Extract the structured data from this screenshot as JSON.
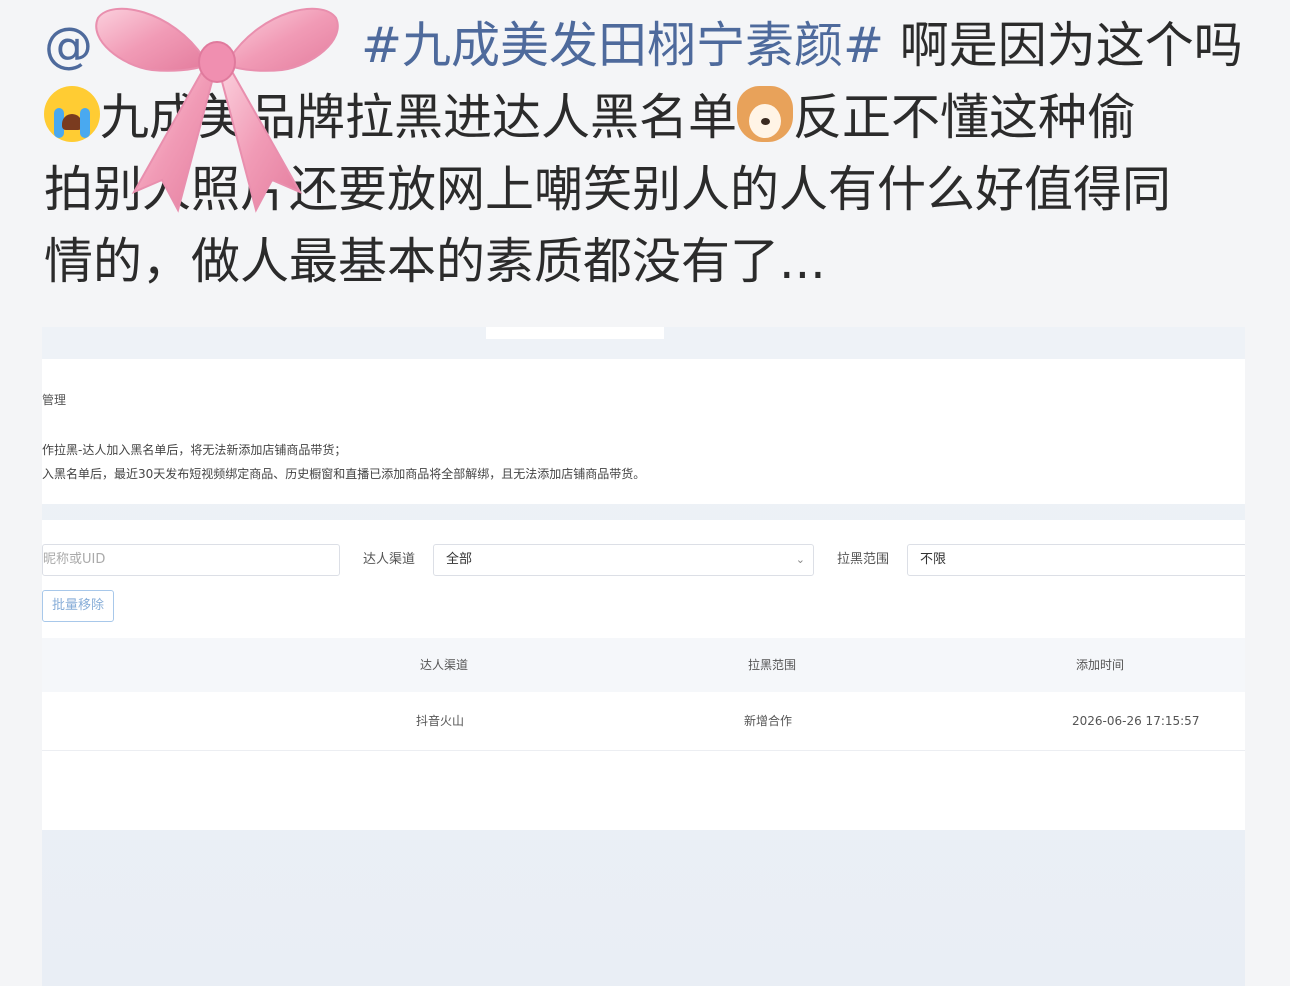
{
  "post": {
    "mention": "@",
    "topic": "#九成美发田栩宁素颜#",
    "line1_rest": " 啊是因为这个吗",
    "line2_a": "九成美",
    "line2_b": "品牌拉黑进达人黑名单",
    "line2_c": "反正不懂这种偷",
    "line3": "拍别人照片还要放网上嘲笑别人的人有什么好值得同",
    "line4": "情的，做人最基本的素质都没有了...",
    "emojis": [
      "crying-face-icon",
      "dog-face-icon"
    ]
  },
  "screenshot": {
    "notice_title": "管理",
    "notice_line1": "作拉黑-达人加入黑名单后，将无法新添加店铺商品带货；",
    "notice_line2": "入黑名单后，最近30天发布短视频绑定商品、历史橱窗和直播已添加商品将全部解绑，且无法添加店铺商品带货。",
    "search_placeholder": "昵称或UID",
    "channel_label": "达人渠道",
    "channel_value": "全部",
    "range_label": "拉黑范围",
    "range_value": "不限",
    "batch_remove": "批量移除",
    "table": {
      "headers": [
        "达人渠道",
        "拉黑范围",
        "添加时间"
      ],
      "rows": [
        [
          "抖音火山",
          "新增合作",
          "2026-06-26 17:15:57"
        ]
      ]
    }
  },
  "colors": {
    "link": "#4e6a9c",
    "text": "#2b2b2b",
    "bow": "#f4a7bf"
  }
}
